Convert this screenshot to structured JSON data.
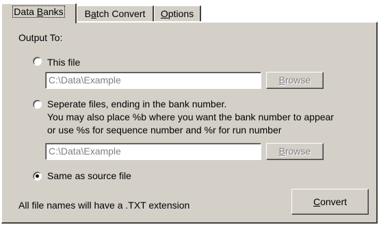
{
  "tabs": [
    {
      "label": "Data Banks",
      "underline_index": 5,
      "active": true
    },
    {
      "label": "Batch Convert",
      "underline_index": 1,
      "active": false
    },
    {
      "label": "Options",
      "underline_index": 0,
      "active": false
    }
  ],
  "output": {
    "heading": "Output To:",
    "this_file": {
      "label": "This file",
      "selected": false,
      "path": "C:\\Data\\Example",
      "browse_label": "Browse",
      "browse_underline_index": 0
    },
    "separate_files": {
      "label_lines": [
        "Seperate files, ending in the bank number.",
        "You may also place %b where you want the bank number to appear",
        "or use %s for sequence number and %r for run number"
      ],
      "selected": false,
      "path": "C:\\Data\\Example",
      "browse_label": "Browse",
      "browse_underline_index": 0
    },
    "same_as_source": {
      "label": "Same as source file",
      "selected": true
    }
  },
  "footer": {
    "note": "All file names will have a .TXT extension",
    "convert_label": "Convert",
    "convert_underline_index": 0
  }
}
